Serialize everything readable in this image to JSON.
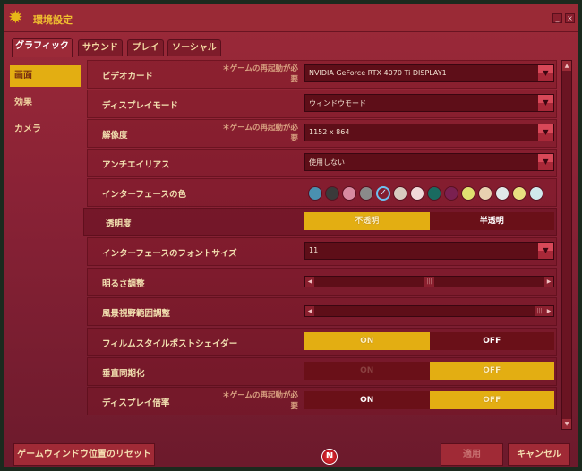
{
  "window": {
    "title": "環境設定",
    "minimize": "_",
    "close": "×"
  },
  "tabs": [
    "グラフィック",
    "サウンド",
    "プレイ",
    "ソーシャル"
  ],
  "sidebar": [
    "画面",
    "効果",
    "カメラ"
  ],
  "restart_note": "＊ゲームの再起動が必要",
  "rows": {
    "video_card": {
      "label": "ビデオカード",
      "value": "NVIDIA GeForce RTX 4070 Ti DISPLAY1"
    },
    "display_mode": {
      "label": "ディスプレイモード",
      "value": "ウィンドウモード"
    },
    "resolution": {
      "label": "解像度",
      "value": "1152 x 864"
    },
    "antialias": {
      "label": "アンチエイリアス",
      "value": "使用しない"
    },
    "ui_color": {
      "label": "インターフェースの色",
      "colors": [
        "#4a90b0",
        "#3a3a3a",
        "#d88aa0",
        "#8a8a8a",
        "#3a6aa0",
        "#d8ccc0",
        "#f0d8d8",
        "#1a6a60",
        "#7a2050",
        "#e0e070",
        "#e8d0b0",
        "#e0e8e8",
        "#e8e080",
        "#d0e8ec"
      ],
      "selected_index": 4
    },
    "transparency": {
      "label": "透明度",
      "options": [
        "不透明",
        "半透明"
      ],
      "selected": "不透明"
    },
    "font_size": {
      "label": "インターフェースのフォントサイズ",
      "value": "11"
    },
    "brightness": {
      "label": "明るさ調整",
      "value_percent": 50
    },
    "view_range": {
      "label": "風景視野範囲調整",
      "value_percent": 100
    },
    "film_shader": {
      "label": "フィルムスタイルポストシェイダー",
      "on": "ON",
      "off": "OFF",
      "selected": "ON"
    },
    "vsync": {
      "label": "垂直同期化",
      "on": "ON",
      "off": "OFF",
      "selected": "OFF"
    },
    "display_scale": {
      "label": "ディスプレイ倍率",
      "on": "ON",
      "off": "OFF",
      "selected": "OFF"
    }
  },
  "buttons": {
    "reset": "ゲームウィンドウ位置のリセット",
    "apply": "適用",
    "cancel": "キャンセル",
    "logo": "N"
  }
}
